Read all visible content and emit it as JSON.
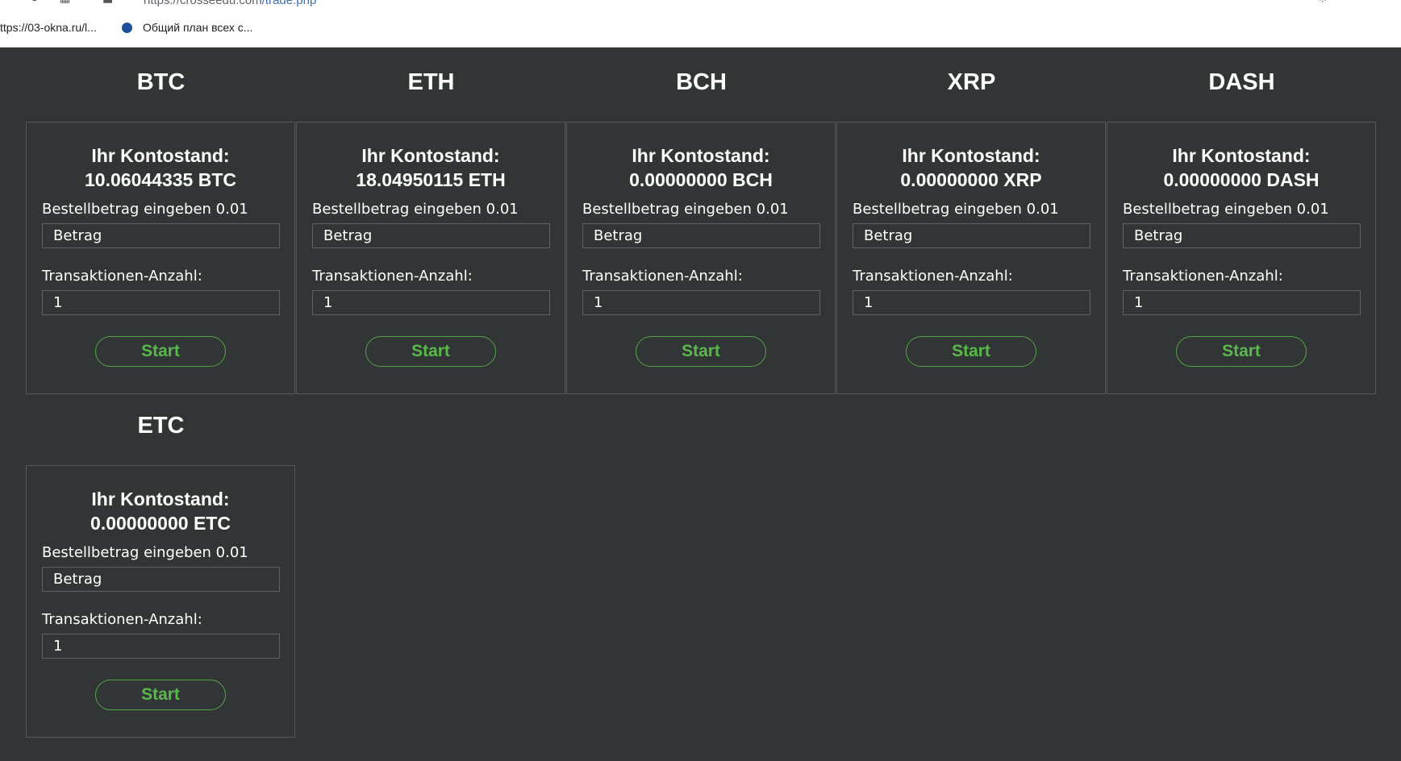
{
  "browser": {
    "url_host": "https://crosseedu.com",
    "url_path": "/trade.php",
    "bookmarks": [
      {
        "label": "ttps://03-okna.ru/l..."
      },
      {
        "label": "Общий план всех с..."
      }
    ]
  },
  "cards": [
    {
      "coin": "BTC",
      "balance_label": "Ihr Kontostand:",
      "balance": "10.06044335 BTC",
      "amount_label": "Bestellbetrag eingeben 0.01",
      "amount_placeholder": "Betrag",
      "tx_label": "Transaktionen-Anzahl:",
      "tx_value": "1",
      "start_label": "Start"
    },
    {
      "coin": "ETH",
      "balance_label": "Ihr Kontostand:",
      "balance": "18.04950115 ETH",
      "amount_label": "Bestellbetrag eingeben 0.01",
      "amount_placeholder": "Betrag",
      "tx_label": "Transaktionen-Anzahl:",
      "tx_value": "1",
      "start_label": "Start"
    },
    {
      "coin": "BCH",
      "balance_label": "Ihr Kontostand:",
      "balance": "0.00000000 BCH",
      "amount_label": "Bestellbetrag eingeben 0.01",
      "amount_placeholder": "Betrag",
      "tx_label": "Transaktionen-Anzahl:",
      "tx_value": "1",
      "start_label": "Start"
    },
    {
      "coin": "XRP",
      "balance_label": "Ihr Kontostand:",
      "balance": "0.00000000 XRP",
      "amount_label": "Bestellbetrag eingeben 0.01",
      "amount_placeholder": "Betrag",
      "tx_label": "Transaktionen-Anzahl:",
      "tx_value": "1",
      "start_label": "Start"
    },
    {
      "coin": "DASH",
      "balance_label": "Ihr Kontostand:",
      "balance": "0.00000000 DASH",
      "amount_label": "Bestellbetrag eingeben 0.01",
      "amount_placeholder": "Betrag",
      "tx_label": "Transaktionen-Anzahl:",
      "tx_value": "1",
      "start_label": "Start"
    },
    {
      "coin": "ETC",
      "balance_label": "Ihr Kontostand:",
      "balance": "0.00000000 ETC",
      "amount_label": "Bestellbetrag eingeben 0.01",
      "amount_placeholder": "Betrag",
      "tx_label": "Transaktionen-Anzahl:",
      "tx_value": "1",
      "start_label": "Start"
    }
  ],
  "colors": {
    "page_bg": "#323536",
    "card_border": "#53585a",
    "accent_green": "#58b84a",
    "text": "#ffffff"
  },
  "icons": [
    "back-icon",
    "tabs-icon",
    "lock-icon",
    "bookmark-favicon",
    "toolbar-icons"
  ]
}
